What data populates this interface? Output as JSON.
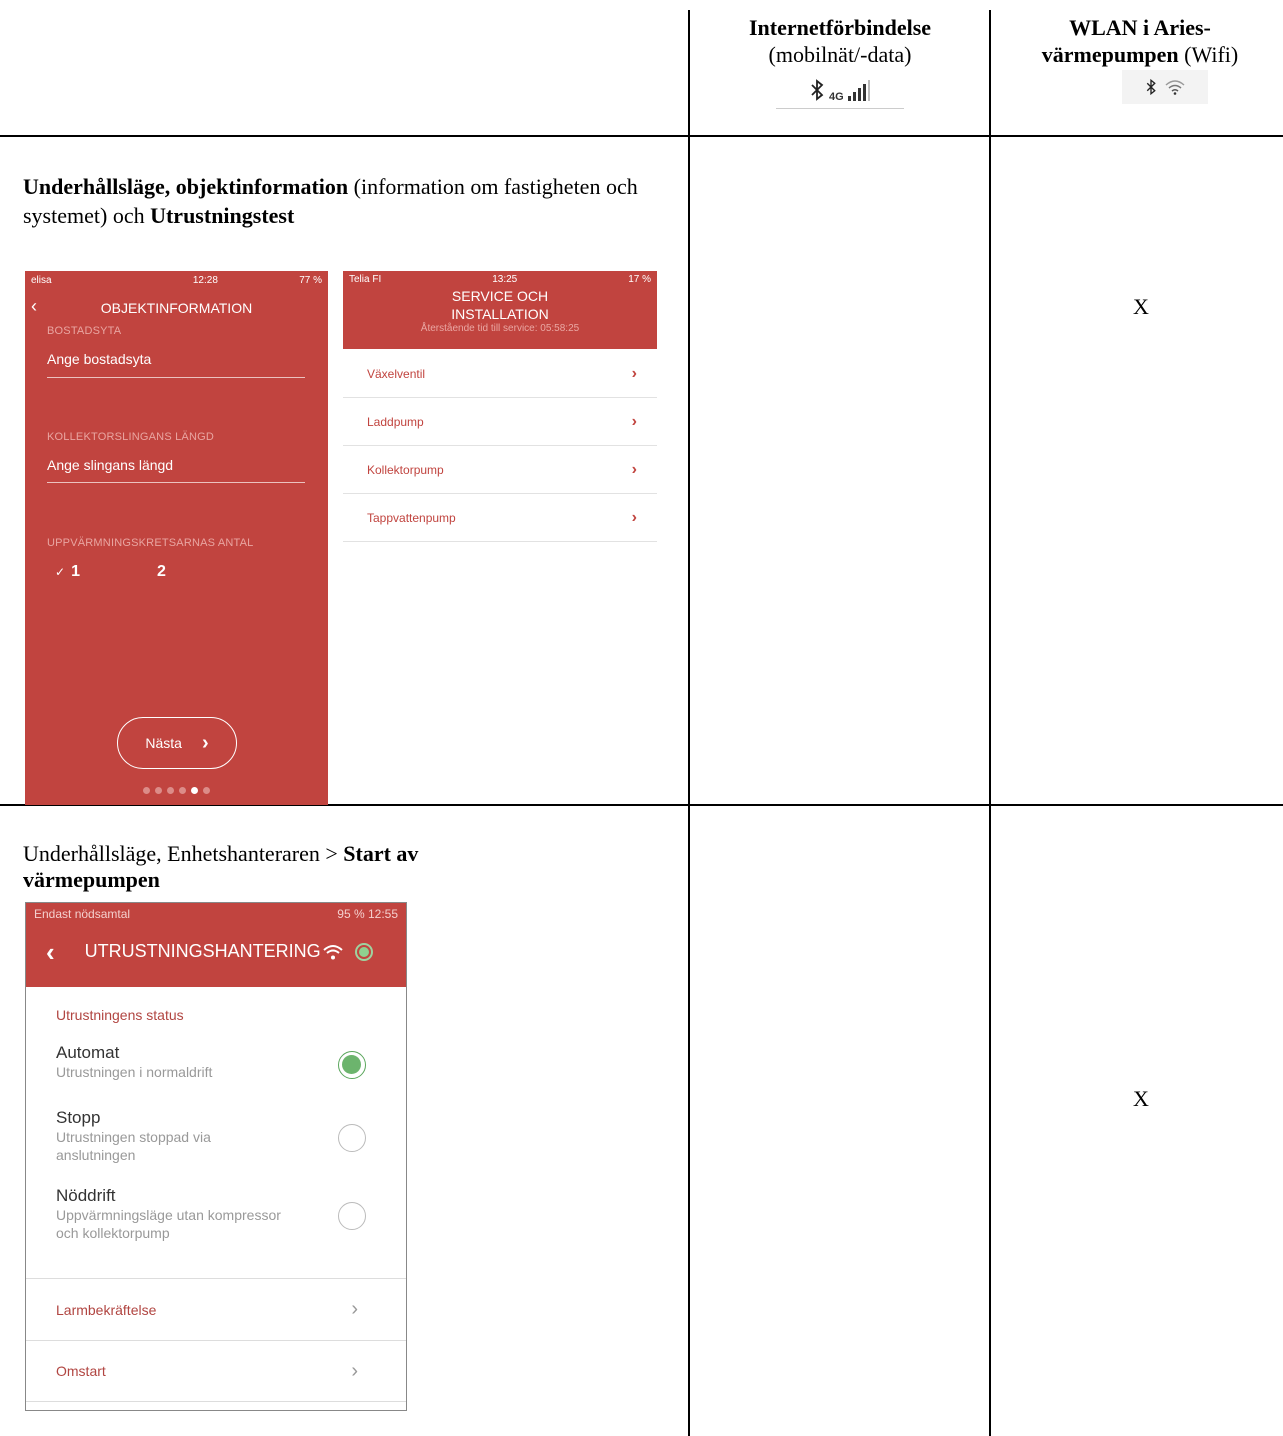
{
  "header": {
    "col2_title": "Internetförbindelse",
    "col2_sub": "(mobilnät/-data)",
    "col2_net": "4G",
    "col3_title": "WLAN i Aries-värmepumpen",
    "col3_sub": "(Wifi)"
  },
  "row1": {
    "text_bold1": "Underhållsläge, objektinformation",
    "text_plain1": " (information om fastigheten och systemet) och ",
    "text_bold2": "Utrustningstest",
    "mark": "X",
    "phone1": {
      "carrier": "elisa",
      "time": "12:28",
      "battery": "77 %",
      "title": "OBJEKTINFORMATION",
      "label1": "BOSTADSYTA",
      "input1": "Ange bostadsyta",
      "label2": "KOLLEKTORSLINGANS LÄNGD",
      "input2": "Ange slingans längd",
      "label3": "UPPVÄRMNINGSKRETSARNAS ANTAL",
      "opt1": "1",
      "opt2": "2",
      "next": "Nästa"
    },
    "phone2": {
      "carrier": "Telia FI",
      "time": "13:25",
      "battery": "17 %",
      "title1": "SERVICE OCH",
      "title2": "INSTALLATION",
      "subtitle": "Återstående tid till service: 05:58:25",
      "items": [
        "Växelventil",
        "Laddpump",
        "Kollektorpump",
        "Tappvattenpump"
      ]
    }
  },
  "row2": {
    "text_plain": "Underhållsläge, Enhetshanteraren > ",
    "text_bold": "Start av värmepumpen",
    "mark": "X",
    "phone3": {
      "status_left": "Endast nödsamtal",
      "status_right": "95 %",
      "time": "12:55",
      "title": "UTRUSTNINGSHANTERING",
      "section": "Utrustningens status",
      "options": [
        {
          "name": "Automat",
          "desc": "Utrustningen i normaldrift"
        },
        {
          "name": "Stopp",
          "desc": "Utrustningen stoppad via anslutningen"
        },
        {
          "name": "Nöddrift",
          "desc": "Uppvärmningsläge utan kompressor och kollektorpump"
        }
      ],
      "selected": "Automat",
      "link1": "Larmbekräftelse",
      "link2": "Omstart"
    }
  }
}
